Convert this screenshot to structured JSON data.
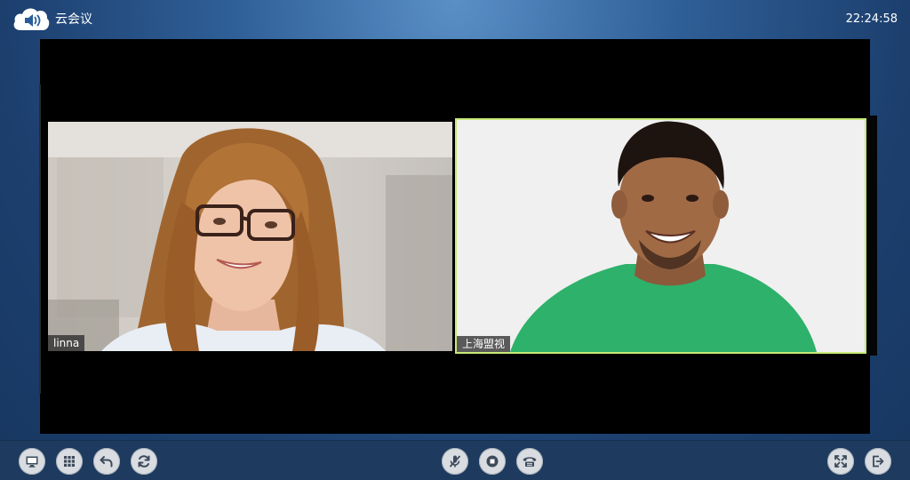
{
  "app": {
    "title": "云会议",
    "logo_icon": "cloud-speaker-icon"
  },
  "clock": "22:24:58",
  "participants": [
    {
      "name": "linna",
      "active_speaker": false
    },
    {
      "name": "上海盟视",
      "active_speaker": true,
      "highlight_color": "#c7ea7a"
    }
  ],
  "toolbar": {
    "left": [
      {
        "icon": "monitor-icon",
        "action": "screen"
      },
      {
        "icon": "grid-icon",
        "action": "layout"
      },
      {
        "icon": "undo-arrow-icon",
        "action": "back"
      },
      {
        "icon": "refresh-icon",
        "action": "refresh"
      }
    ],
    "center": [
      {
        "icon": "mic-muted-icon",
        "action": "mute"
      },
      {
        "icon": "record-icon",
        "action": "record"
      },
      {
        "icon": "telephone-icon",
        "action": "call"
      }
    ],
    "right": [
      {
        "icon": "fullscreen-icon",
        "action": "fullscreen"
      },
      {
        "icon": "exit-icon",
        "action": "exit"
      }
    ]
  }
}
